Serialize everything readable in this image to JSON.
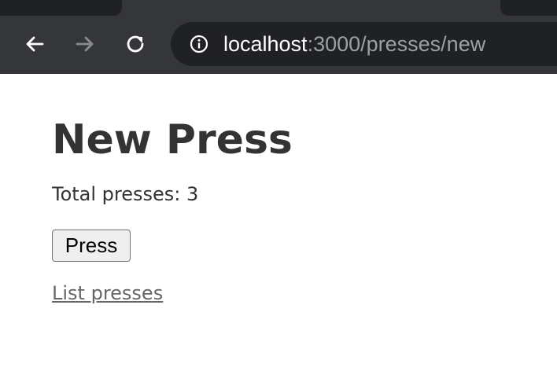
{
  "browser": {
    "url_host": "localhost",
    "url_path": ":3000/presses/new",
    "icons": {
      "back": "back-arrow-icon",
      "forward": "forward-arrow-icon",
      "reload": "reload-icon",
      "info": "info-icon"
    },
    "forward_enabled": false
  },
  "page": {
    "title": "New Press",
    "total_label": "Total presses: ",
    "total_value": "3",
    "press_button_label": "Press",
    "list_link_label": "List presses"
  },
  "colors": {
    "chrome_bg": "#35363a",
    "omnibox_bg": "#202124",
    "text": "#333333",
    "link": "#666666"
  }
}
